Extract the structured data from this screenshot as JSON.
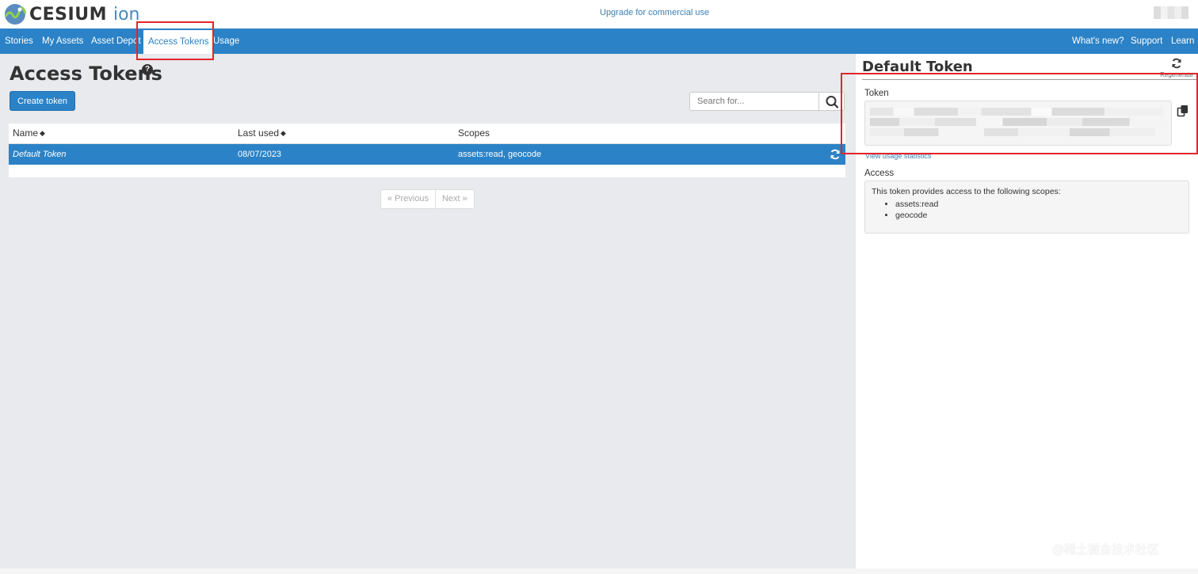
{
  "header": {
    "logo_text": "CESIUM",
    "logo_suffix": "ion",
    "upgrade_link": "Upgrade for commercial use"
  },
  "nav": {
    "left": [
      "Stories",
      "My Assets",
      "Asset Depot",
      "Access Tokens",
      "Usage"
    ],
    "active": "Access Tokens",
    "right": [
      "What's new?",
      "Support",
      "Learn"
    ]
  },
  "page": {
    "title": "Access Tokens",
    "help_glyph": "?",
    "create_button": "Create token",
    "search_placeholder": "Search for..."
  },
  "table": {
    "columns": [
      "Name",
      "Last used",
      "Scopes"
    ],
    "rows": [
      {
        "name": "Default Token",
        "last_used": "08/07/2023",
        "scopes": "assets:read, geocode",
        "selected": true
      }
    ]
  },
  "pagination": {
    "previous": "« Previous",
    "next": "Next »"
  },
  "panel": {
    "title": "Default Token",
    "regenerate_label": "Regenerate",
    "token_label": "Token",
    "usage_link": "View usage statistics",
    "access_label": "Access",
    "access_intro": "This token provides access to the following scopes:",
    "scopes": [
      "assets:read",
      "geocode"
    ]
  },
  "watermark": "@稀土掘金技术社区",
  "colors": {
    "primary": "#2b82c6",
    "highlight": "#e0262b",
    "background": "#e8eaed"
  }
}
